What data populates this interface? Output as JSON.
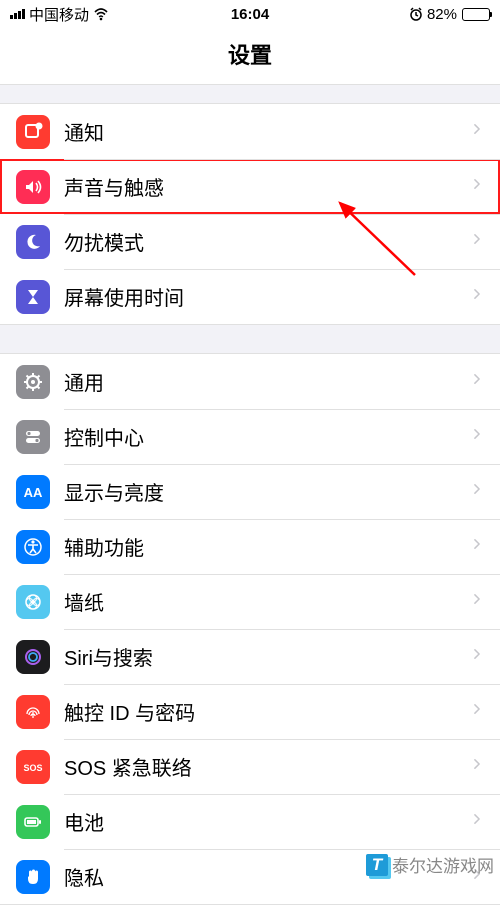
{
  "statusbar": {
    "carrier": "中国移动",
    "time": "16:04",
    "battery_pct": "82%"
  },
  "header": {
    "title": "设置"
  },
  "groups": [
    {
      "items": [
        {
          "id": "notifications",
          "label": "通知",
          "icon": "notification-icon",
          "bg": "#ff3b30",
          "highlighted": false
        },
        {
          "id": "sounds",
          "label": "声音与触感",
          "icon": "sound-icon",
          "bg": "#ff2d55",
          "highlighted": true
        },
        {
          "id": "dnd",
          "label": "勿扰模式",
          "icon": "moon-icon",
          "bg": "#5856d6",
          "highlighted": false
        },
        {
          "id": "screentime",
          "label": "屏幕使用时间",
          "icon": "hourglass-icon",
          "bg": "#5856d6",
          "highlighted": false
        }
      ]
    },
    {
      "items": [
        {
          "id": "general",
          "label": "通用",
          "icon": "gear-icon",
          "bg": "#8e8e93",
          "highlighted": false
        },
        {
          "id": "control-center",
          "label": "控制中心",
          "icon": "switches-icon",
          "bg": "#8e8e93",
          "highlighted": false
        },
        {
          "id": "display",
          "label": "显示与亮度",
          "icon": "aa-icon",
          "bg": "#007aff",
          "highlighted": false
        },
        {
          "id": "accessibility",
          "label": "辅助功能",
          "icon": "accessibility-icon",
          "bg": "#007aff",
          "highlighted": false
        },
        {
          "id": "wallpaper",
          "label": "墙纸",
          "icon": "wallpaper-icon",
          "bg": "#54c8f0",
          "highlighted": false
        },
        {
          "id": "siri",
          "label": "Siri与搜索",
          "icon": "siri-icon",
          "bg": "#1c1c1e",
          "highlighted": false
        },
        {
          "id": "touchid",
          "label": "触控 ID 与密码",
          "icon": "fingerprint-icon",
          "bg": "#ff3b30",
          "highlighted": false
        },
        {
          "id": "sos",
          "label": "SOS 紧急联络",
          "icon": "sos-icon",
          "bg": "#ff3b30",
          "highlighted": false
        },
        {
          "id": "battery",
          "label": "电池",
          "icon": "battery-icon",
          "bg": "#34c759",
          "highlighted": false
        },
        {
          "id": "privacy",
          "label": "隐私",
          "icon": "hand-icon",
          "bg": "#007aff",
          "highlighted": false
        }
      ]
    }
  ],
  "annotation": {
    "type": "arrow",
    "color": "#ff0000"
  },
  "watermark": {
    "text": "泰尔达游戏网",
    "badge": "T"
  }
}
